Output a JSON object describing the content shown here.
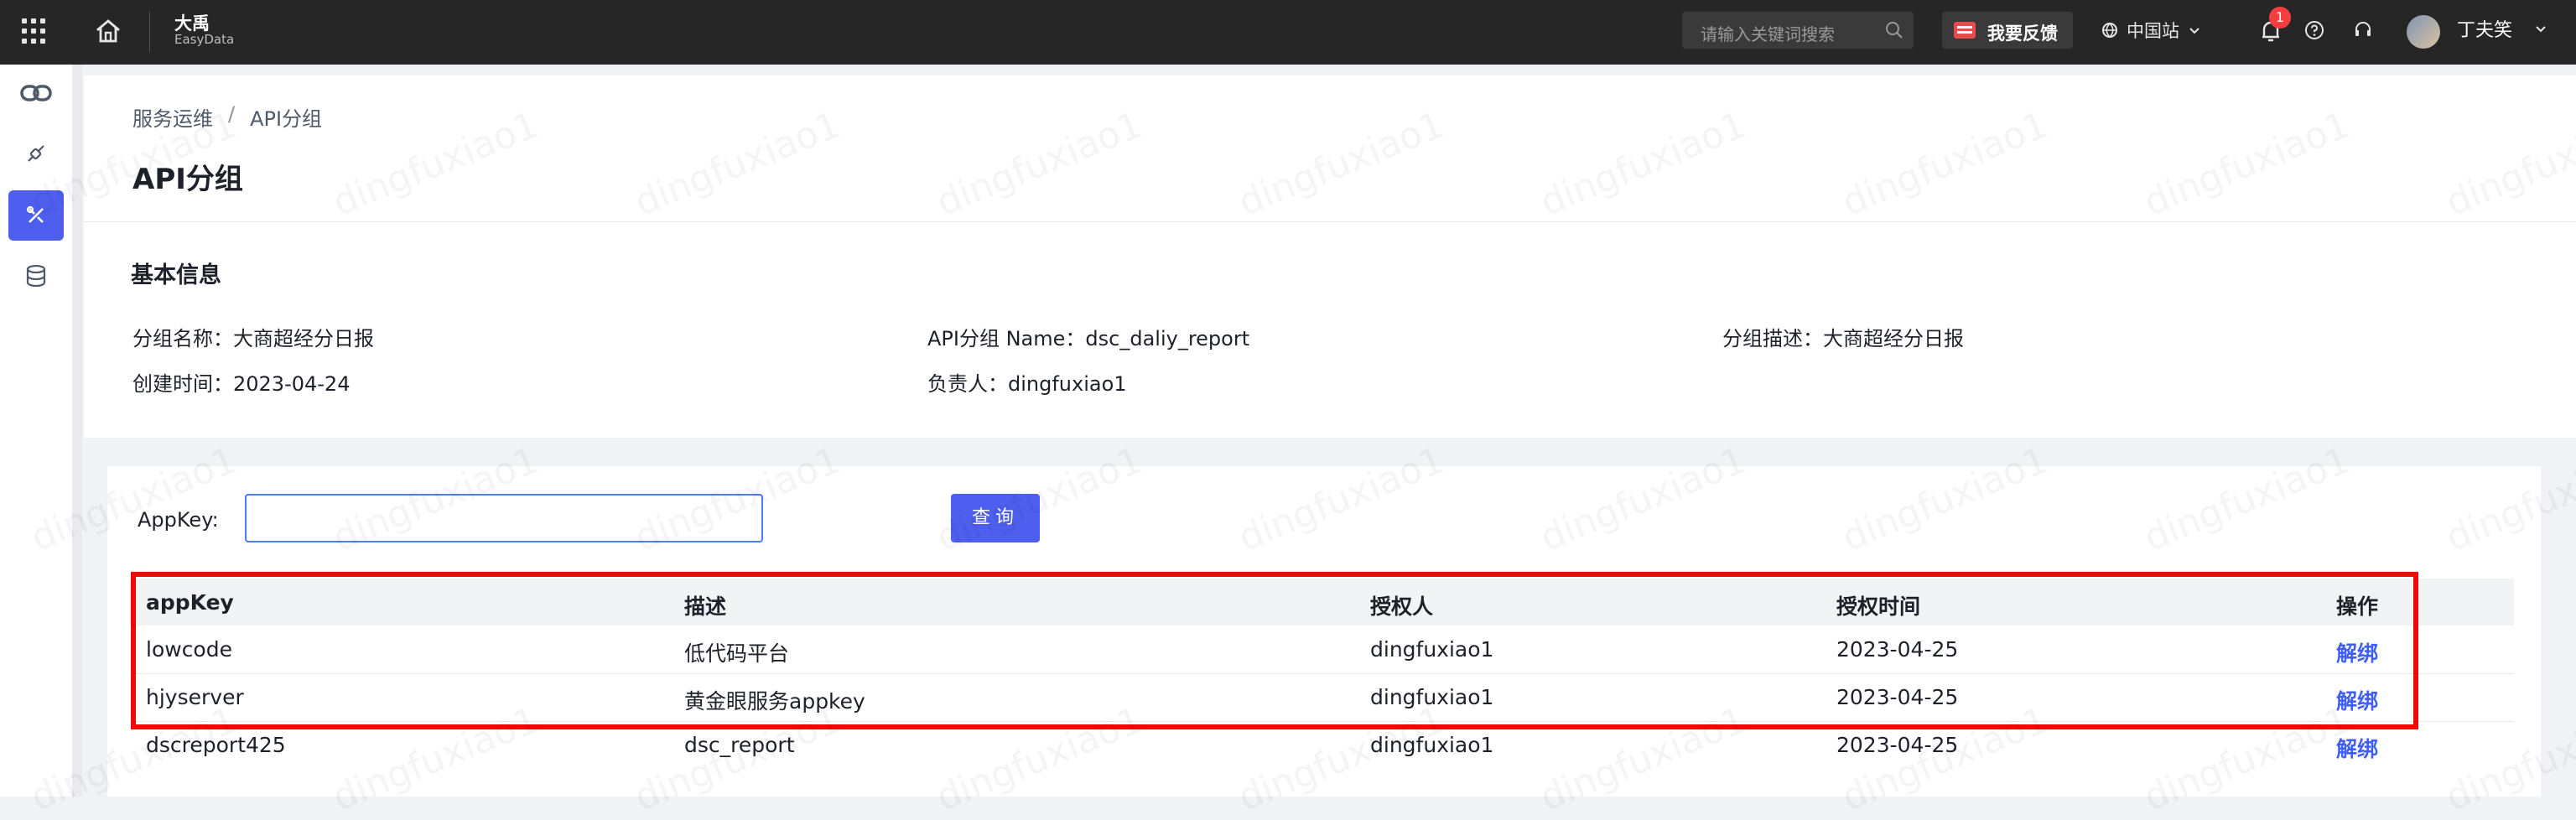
{
  "topbar": {
    "brand_cn": "大禹",
    "brand_en": "EasyData",
    "search_placeholder": "请输入关键词搜索",
    "feedback_label": "我要反馈",
    "region_label": "中国站",
    "notification_count": "1",
    "user_name": "丁夫笑"
  },
  "breadcrumb": {
    "parent": "服务运维",
    "separator": "/",
    "current": "API分组"
  },
  "page_title": "API分组",
  "basic_info": {
    "title": "基本信息",
    "group_name": "分组名称：大商超经分日报",
    "api_group_name": "API分组 Name：dsc_daliy_report",
    "group_desc": "分组描述：大商超经分日报",
    "created_at": "创建时间：2023-04-24",
    "owner": "负责人：dingfuxiao1"
  },
  "search": {
    "appkey_label": "AppKey:",
    "appkey_value": "",
    "query_button": "查询"
  },
  "table": {
    "columns": [
      "appKey",
      "描述",
      "授权人",
      "授权时间",
      "操作"
    ],
    "rows": [
      {
        "appkey": "lowcode",
        "desc": "低代码平台",
        "grantor": "dingfuxiao1",
        "time": "2023-04-25",
        "action": "解绑"
      },
      {
        "appkey": "hjyserver",
        "desc": "黄金眼服务appkey",
        "grantor": "dingfuxiao1",
        "time": "2023-04-25",
        "action": "解绑"
      },
      {
        "appkey": "dscreport425",
        "desc": "dsc_report",
        "grantor": "dingfuxiao1",
        "time": "2023-04-25",
        "action": "解绑"
      }
    ]
  },
  "watermark": "dingfuxiao1",
  "colors": {
    "primary": "#4e5ff0",
    "link": "#3f5ef2",
    "highlight": "#f00707",
    "topbar": "#262626"
  }
}
